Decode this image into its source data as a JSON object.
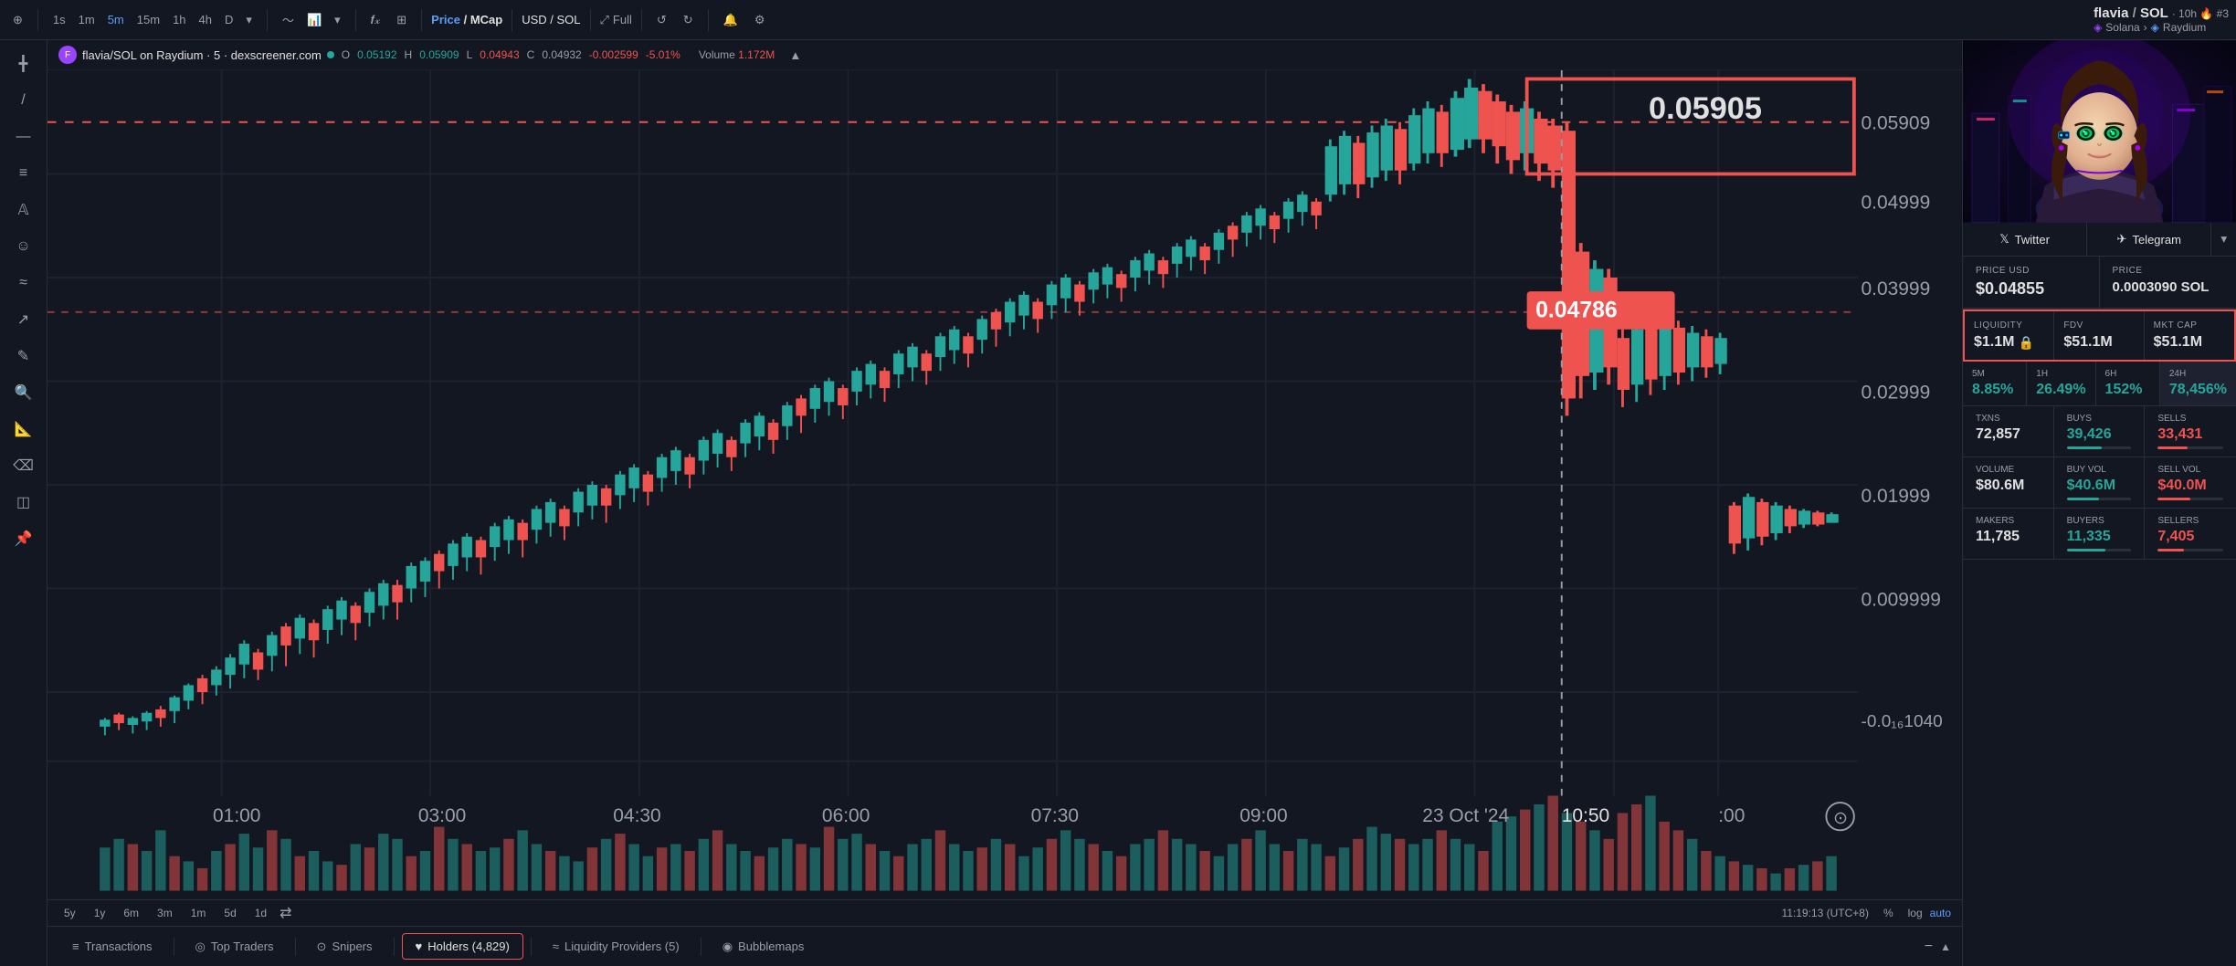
{
  "toolbar": {
    "timeframes": [
      "1s",
      "1m",
      "5m",
      "15m",
      "1h",
      "4h",
      "D"
    ],
    "active_timeframe": "5m",
    "chart_types": [
      "line",
      "candle",
      "bar"
    ],
    "price_mcap_label": "Price / MCap",
    "usd_sol_label": "USD / SOL",
    "full_label": "Full",
    "undo_icon": "↺",
    "redo_icon": "↻",
    "settings_icon": "⚙",
    "alert_icon": "🔔"
  },
  "pair": {
    "name": "flavia",
    "separator": "/",
    "quote": "SOL",
    "timeframe": "10h",
    "rank": "#3",
    "network": "Solana",
    "dex": "Raydium",
    "full_name": "flavia/SOL on Raydium · 5 · dexscreener.com"
  },
  "ohlc": {
    "open_label": "O",
    "open_value": "0.05192",
    "high_label": "H",
    "high_value": "0.05909",
    "low_label": "L",
    "low_value": "0.04943",
    "close_label": "C",
    "close_value": "0.04932",
    "change_value": "-0.002599",
    "change_pct": "-5.01%",
    "volume_label": "Volume",
    "volume_value": "1.172M"
  },
  "chart": {
    "current_price": "0.04786",
    "highlighted_price": "0.05905",
    "price_levels": [
      "0.05909",
      "0.04999",
      "0.03999",
      "0.02999",
      "0.01999",
      "0.009999",
      "-0.0₁₆1040"
    ],
    "time_labels": [
      "01:00",
      "03:00",
      "04:30",
      "06:00",
      "07:30",
      "09:00",
      "23 Oct '24",
      "10:50",
      ":00"
    ],
    "datetime_display": "11:19:13 (UTC+8)"
  },
  "bottom_timeranges": [
    "5y",
    "1y",
    "6m",
    "3m",
    "1m",
    "5d",
    "1d"
  ],
  "bottom_tabs": [
    {
      "id": "transactions",
      "label": "Transactions",
      "icon": "≡",
      "active": false
    },
    {
      "id": "top-traders",
      "label": "Top Traders",
      "icon": "◎",
      "active": false
    },
    {
      "id": "snipers",
      "label": "Snipers",
      "icon": "⊙",
      "active": false
    },
    {
      "id": "holders",
      "label": "Holders (4,829)",
      "icon": "♥",
      "active": true
    },
    {
      "id": "liquidity",
      "label": "Liquidity Providers (5)",
      "icon": "≈",
      "active": false
    },
    {
      "id": "bubblemaps",
      "label": "Bubblemaps",
      "icon": "◉",
      "active": false
    }
  ],
  "right_panel": {
    "social": {
      "twitter_label": "Twitter",
      "telegram_label": "Telegram"
    },
    "price_usd": {
      "label": "PRICE USD",
      "value": "$0.04855"
    },
    "price_sol": {
      "label": "PRICE",
      "value": "0.0003090 SOL"
    },
    "liquidity": {
      "label": "LIQUIDITY",
      "value": "$1.1M"
    },
    "fdv": {
      "label": "FDV",
      "value": "$51.1M"
    },
    "mkt_cap": {
      "label": "MKT CAP",
      "value": "$51.1M"
    },
    "changes": {
      "5m": {
        "label": "5M",
        "value": "8.85%",
        "positive": true
      },
      "1h": {
        "label": "1H",
        "value": "26.49%",
        "positive": true
      },
      "6h": {
        "label": "6H",
        "value": "152%",
        "positive": true
      },
      "24h": {
        "label": "24H",
        "value": "78,456%",
        "positive": true
      }
    },
    "txns": {
      "label": "TXNS",
      "value": "72,857",
      "buys_label": "BUYS",
      "buys_value": "39,426",
      "sells_label": "SELLS",
      "sells_value": "33,431",
      "buys_pct": 54,
      "sells_pct": 46
    },
    "volume": {
      "label": "VOLUME",
      "value": "$80.6M",
      "buy_vol_label": "BUY VOL",
      "buy_vol_value": "$40.6M",
      "sell_vol_label": "SELL VOL",
      "sell_vol_value": "$40.0M",
      "buy_pct": 50,
      "sell_pct": 50
    },
    "makers": {
      "label": "MAKERS",
      "value": "11,785",
      "buyers_label": "BUYERS",
      "buyers_value": "11,335",
      "sellers_label": "SELLERS",
      "sellers_value": "7,405",
      "buyers_pct": 60,
      "sellers_pct": 40
    }
  }
}
